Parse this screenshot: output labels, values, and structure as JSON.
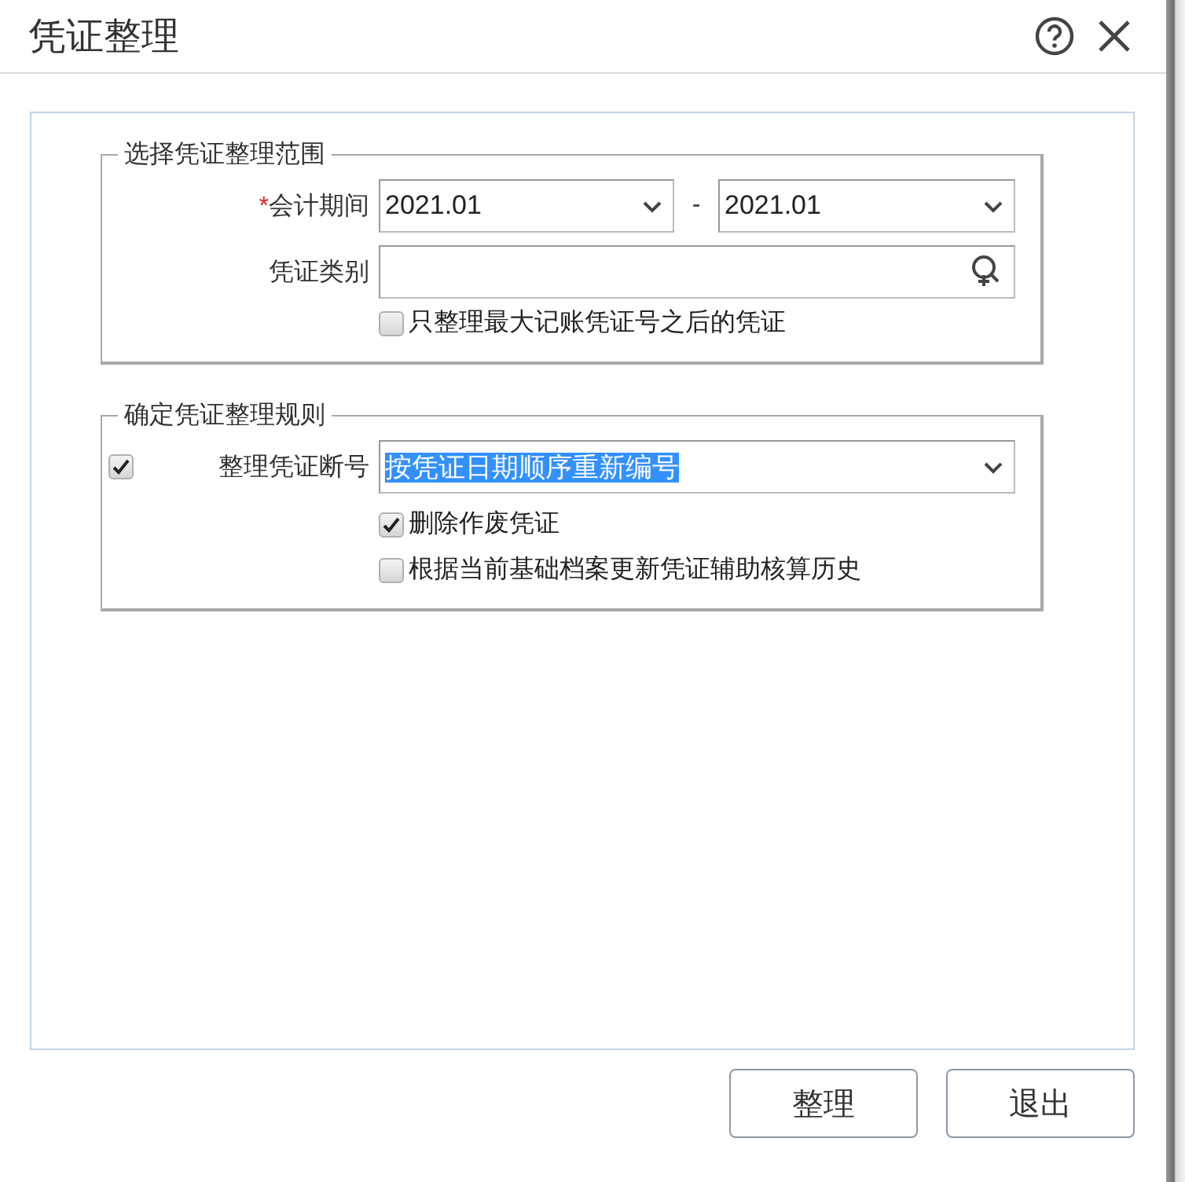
{
  "window": {
    "title": "凭证整理"
  },
  "range_group": {
    "legend": "选择凭证整理范围",
    "period": {
      "label": "会计期间",
      "required_mark": "*",
      "from": "2021.01",
      "separator": "-",
      "to": "2021.01"
    },
    "category": {
      "label": "凭证类别"
    },
    "only_after_max": {
      "label": "只整理最大记账凭证号之后的凭证",
      "checked": false
    }
  },
  "rules_group": {
    "legend": "确定凭证整理规则",
    "renumber": {
      "checked": true,
      "label": "整理凭证断号",
      "value": "按凭证日期顺序重新编号",
      "text_selected": true
    },
    "options": [
      {
        "label": "删除作废凭证",
        "checked": true
      },
      {
        "label": "根据当前基础档案更新凭证辅助核算历史",
        "checked": false
      }
    ]
  },
  "buttons": [
    {
      "label": "整理"
    },
    {
      "label": "退出"
    }
  ]
}
